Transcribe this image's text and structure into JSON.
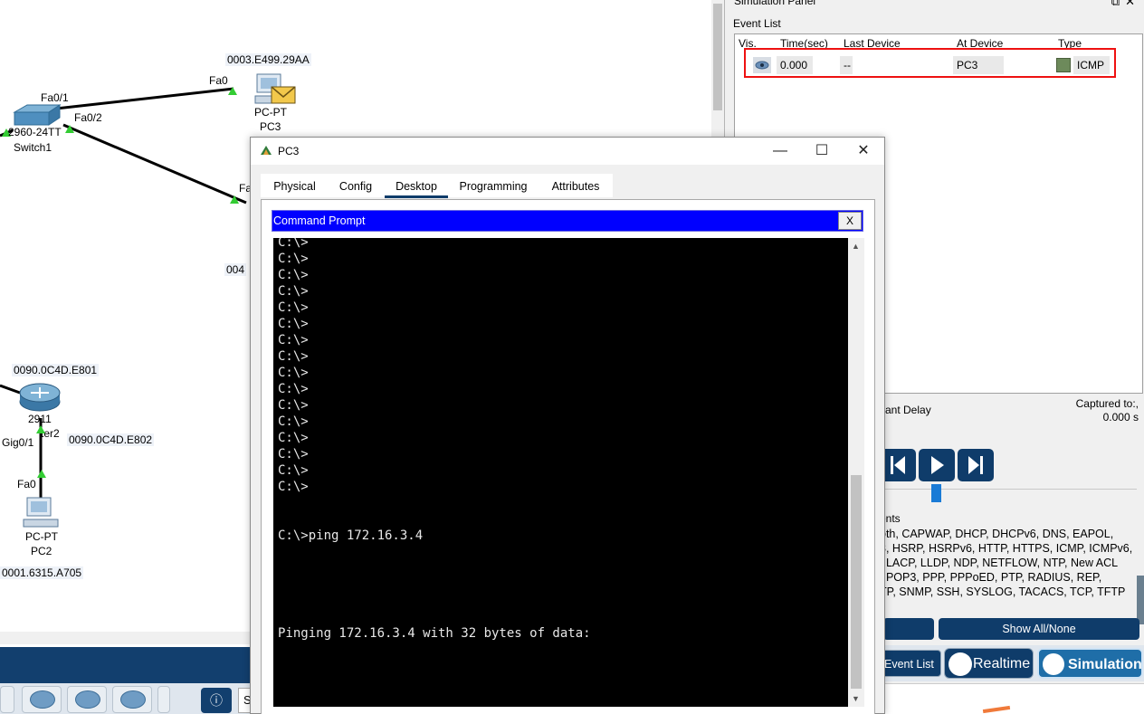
{
  "topology": {
    "switch1": {
      "model": "2960-24TT",
      "name": "Switch1",
      "port_a": "Fa0/1",
      "port_b": "Fa0/2"
    },
    "pc3_node": {
      "mac": "0003.E499.29AA",
      "port": "Fa0",
      "type": "PC-PT",
      "name": "PC3"
    },
    "hidden_node": {
      "port_partial": "Fa",
      "mac_partial": "004"
    },
    "router2": {
      "mac_top": "0090.0C4D.E801",
      "model_partial": "2911",
      "name_partial": "ter2",
      "port": "Gig0/1",
      "mac_right": "0090.0C4D.E802"
    },
    "pc2_node": {
      "port": "Fa0",
      "type": "PC-PT",
      "name": "PC2",
      "mac": "0001.6315.A705"
    }
  },
  "bottom_toolbar": {
    "info_icon": "info-icon",
    "search_text": "S"
  },
  "simulation_panel": {
    "title": "Simulation Panel",
    "event_list_label": "Event List",
    "columns": [
      "Vis.",
      "Time(sec)",
      "Last Device",
      "At Device",
      "Type"
    ],
    "events": [
      {
        "time": "0.000",
        "last_device": "--",
        "at_device": "PC3",
        "type": "ICMP",
        "type_color": "#6d8a5b"
      }
    ],
    "constant_delay_label": "ant Delay",
    "captured_label": "Captured to:,",
    "captured_value": "0.000 s",
    "event_filters_label": "ents",
    "filter_lines": [
      "oth, CAPWAP, DHCP, DHCPv6, DNS, EAPOL,",
      "3, HSRP, HSRPv6, HTTP, HTTPS, ICMP, ICMPv6,",
      ", LACP, LLDP, NDP, NETFLOW, NTP, New ACL",
      ", POP3, PPP, PPPoED, PTP, RADIUS, REP,",
      "TP, SNMP, SSH, SYSLOG, TACACS, TCP, TFTP"
    ],
    "show_all_label": "Show All/None",
    "event_list_button": "Event List",
    "realtime_button": "Realtime",
    "simulation_button": "Simulation"
  },
  "pc3_window": {
    "title": "PC3",
    "tabs": [
      "Physical",
      "Config",
      "Desktop",
      "Programming",
      "Attributes"
    ],
    "active_tab": "Desktop",
    "command_prompt": {
      "title": "Command Prompt",
      "close_label": "X",
      "prompt_line": "C:\\>",
      "prompt_repeat": 24,
      "ping_command": "C:\\>ping 172.16.3.4",
      "ping_output": "Pinging 172.16.3.4 with 32 bytes of data:"
    }
  }
}
